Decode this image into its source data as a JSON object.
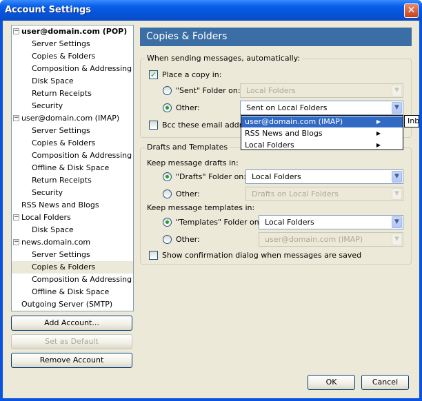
{
  "window": {
    "title": "Account Settings",
    "close_label": "✕"
  },
  "tree": {
    "items": [
      {
        "label": "user@domain.com  (POP)",
        "level": 0,
        "bold": true,
        "expander": "−"
      },
      {
        "label": "Server Settings",
        "level": 1
      },
      {
        "label": "Copies & Folders",
        "level": 1
      },
      {
        "label": "Composition & Addressing",
        "level": 1
      },
      {
        "label": "Disk Space",
        "level": 1
      },
      {
        "label": "Return Receipts",
        "level": 1
      },
      {
        "label": "Security",
        "level": 1
      },
      {
        "label": "user@domain.com  (IMAP)",
        "level": 0,
        "expander": "−"
      },
      {
        "label": "Server Settings",
        "level": 1
      },
      {
        "label": "Copies & Folders",
        "level": 1
      },
      {
        "label": "Composition & Addressing",
        "level": 1
      },
      {
        "label": "Offline & Disk Space",
        "level": 1
      },
      {
        "label": "Return Receipts",
        "level": 1
      },
      {
        "label": "Security",
        "level": 1
      },
      {
        "label": "RSS News and Blogs",
        "level": 0
      },
      {
        "label": "Local Folders",
        "level": 0,
        "expander": "−"
      },
      {
        "label": "Disk Space",
        "level": 1
      },
      {
        "label": "news.domain.com",
        "level": 0,
        "expander": "−"
      },
      {
        "label": "Server Settings",
        "level": 1
      },
      {
        "label": "Copies & Folders",
        "level": 1,
        "selected": true
      },
      {
        "label": "Composition & Addressing",
        "level": 1
      },
      {
        "label": "Offline & Disk Space",
        "level": 1
      },
      {
        "label": "Outgoing Server (SMTP)",
        "level": 0
      }
    ]
  },
  "buttons": {
    "add_account": "Add Account...",
    "set_default": "Set as Default",
    "remove_account": "Remove Account",
    "ok": "OK",
    "cancel": "Cancel"
  },
  "panel": {
    "header": "Copies & Folders",
    "sending_group": "When sending messages, automatically:",
    "place_copy": "Place a copy in:",
    "sent_folder_on": "\"Sent\" Folder on:",
    "sent_combo": "Local Folders",
    "other": "Other:",
    "other_combo": "Sent on Local Folders",
    "bcc_label": "Bcc these email address",
    "drafts_group": "Drafts and Templates",
    "keep_drafts": "Keep message drafts in:",
    "drafts_folder_on": "\"Drafts\" Folder on:",
    "drafts_combo": "Local Folders",
    "drafts_other": "Other:",
    "drafts_other_combo": "Drafts on Local Folders",
    "keep_templates": "Keep message templates in:",
    "templates_folder_on": "\"Templates\" Folder on:",
    "templates_combo": "Local Folders",
    "templates_other": "Other:",
    "templates_other_combo": "user@domain.com  (IMAP)",
    "confirm_dialog": "Show confirmation dialog when messages are saved"
  },
  "popup_menu": {
    "items": [
      {
        "label": "user@domain.com  (IMAP)"
      },
      {
        "label": "RSS News and Blogs"
      },
      {
        "label": "Local Folders"
      }
    ],
    "submenu_item": "Inbox"
  }
}
